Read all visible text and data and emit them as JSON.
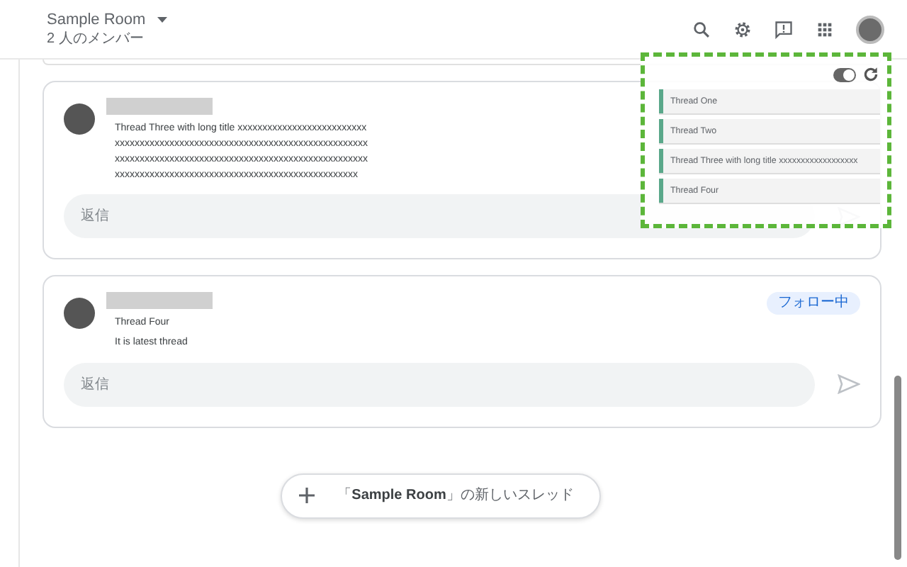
{
  "room": {
    "title": "Sample Room",
    "members": "2 人のメンバー"
  },
  "threads": [
    {
      "title": "Thread Three with long title xxxxxxxxxxxxxxxxxxxxxxxxxxxxxxxxxxxxxxxxxxxxxxxxxxxxxxxxxxxxxxxxxxxxxxxxxxxxxxxxxxxxxxxxxxxxxxxxxxxxxxxxxxxxxxxxxxxxxxxxxxxxxxxxxxxxxxxxxxxxxxxxxxxxxxxxxxxxxxxxxxxxxxxxxxxxxxxxx",
      "reply_placeholder": "返信"
    },
    {
      "title": "Thread Four",
      "message": "It is latest thread",
      "badge": "フォロー中",
      "reply_placeholder": "返信"
    }
  ],
  "new_thread_button": "「**Sample Room**」の新しいスレッド",
  "panel": {
    "toggle_on": true,
    "items": [
      {
        "title": "Thread One"
      },
      {
        "title": "Thread Two"
      },
      {
        "title": "Thread Three with long title xxxxxxxxxxxxxxxxxx"
      },
      {
        "title": "Thread Four"
      }
    ]
  }
}
